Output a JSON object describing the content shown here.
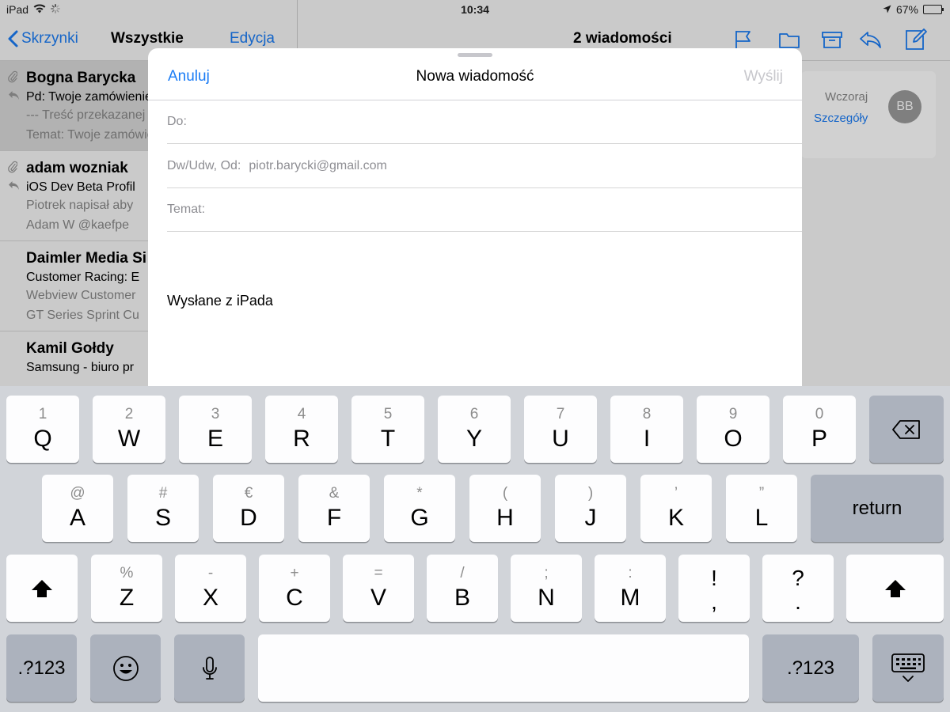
{
  "status_bar": {
    "device": "iPad",
    "time": "10:34",
    "battery_percent": "67%",
    "battery_level": 0.67
  },
  "mailbox_list": {
    "back_label": "Skrzynki",
    "title": "Wszystkie",
    "edit_label": "Edycja",
    "items": [
      {
        "from": "Bogna Barycka",
        "subject": "Pd: Twoje zamówienie",
        "preview1": "--- Treść przekazanej",
        "preview2": "Temat: Twoje zamówienie"
      },
      {
        "from": "adam wozniak",
        "subject": "iOS Dev Beta Profil",
        "preview1": "Piotrek napisał aby",
        "preview2": "Adam W @kaefpe"
      },
      {
        "from": "Daimler Media Si",
        "subject": "Customer Racing: E",
        "preview1": "Webview Customer",
        "preview2": "GT Series Sprint Cu"
      },
      {
        "from": "Kamil Gołdy",
        "subject": "Samsung - biuro pr",
        "preview1": "",
        "preview2": ""
      }
    ]
  },
  "message_detail": {
    "title": "2 wiadomości",
    "date": "Wczoraj",
    "details_label": "Szczegóły",
    "avatar_initials": "BB"
  },
  "compose": {
    "cancel_label": "Anuluj",
    "title": "Nowa wiadomość",
    "send_label": "Wyślij",
    "to_label": "Do:",
    "cc_from_label": "Dw/Udw, Od:",
    "from_value": "piotr.barycki@gmail.com",
    "subject_label": "Temat:",
    "signature": "Wysłane z iPada"
  },
  "keyboard": {
    "row1": [
      {
        "alt": "1",
        "main": "Q"
      },
      {
        "alt": "2",
        "main": "W"
      },
      {
        "alt": "3",
        "main": "E"
      },
      {
        "alt": "4",
        "main": "R"
      },
      {
        "alt": "5",
        "main": "T"
      },
      {
        "alt": "6",
        "main": "Y"
      },
      {
        "alt": "7",
        "main": "U"
      },
      {
        "alt": "8",
        "main": "I"
      },
      {
        "alt": "9",
        "main": "O"
      },
      {
        "alt": "0",
        "main": "P"
      }
    ],
    "row2": [
      {
        "alt": "@",
        "main": "A"
      },
      {
        "alt": "#",
        "main": "S"
      },
      {
        "alt": "€",
        "main": "D"
      },
      {
        "alt": "&",
        "main": "F"
      },
      {
        "alt": "*",
        "main": "G"
      },
      {
        "alt": "(",
        "main": "H"
      },
      {
        "alt": ")",
        "main": "J"
      },
      {
        "alt": "’",
        "main": "K"
      },
      {
        "alt": "”",
        "main": "L"
      }
    ],
    "row3": [
      {
        "alt": "%",
        "main": "Z"
      },
      {
        "alt": "-",
        "main": "X"
      },
      {
        "alt": "+",
        "main": "C"
      },
      {
        "alt": "=",
        "main": "V"
      },
      {
        "alt": "/",
        "main": "B"
      },
      {
        "alt": ";",
        "main": "N"
      },
      {
        "alt": ":",
        "main": "M"
      }
    ],
    "punct1": {
      "top": "!",
      "bottom": ","
    },
    "punct2": {
      "top": "?",
      "bottom": "."
    },
    "return_label": "return",
    "numbers_label": ".?123",
    "icons": {
      "delete": "backspace-icon",
      "shift": "shift-icon",
      "emoji": "emoji-icon",
      "dictation": "microphone-icon",
      "dismiss": "keyboard-dismiss-icon"
    }
  },
  "colors": {
    "accent": "#1a7cf5",
    "disabled": "#c7c7cc",
    "keyboard_bg": "#d1d4d9",
    "key_light": "#fdfdfe",
    "key_dark": "#acb2bd"
  }
}
